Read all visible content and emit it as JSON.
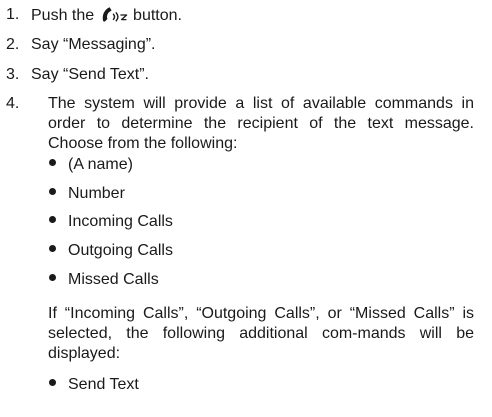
{
  "steps": [
    {
      "number": "1.",
      "text_before": "Push the ",
      "icon": "phone-voice-icon",
      "text_after": " button."
    },
    {
      "number": "2.",
      "text": "Say “Messaging”."
    },
    {
      "number": "3.",
      "text": "Say “Send Text”."
    },
    {
      "number": "4.",
      "paragraph": "The system will provide a list of available commands in order to determine the recipient of the text message. Choose from the following:",
      "options": [
        "(A name)",
        "Number",
        "Incoming Calls",
        "Outgoing Calls",
        "Missed Calls"
      ],
      "note": "If “Incoming Calls”, “Outgoing Calls”, or “Missed Calls” is selected, the following additional com-mands will be displayed:",
      "additional_options": [
        "Send Text"
      ]
    }
  ]
}
